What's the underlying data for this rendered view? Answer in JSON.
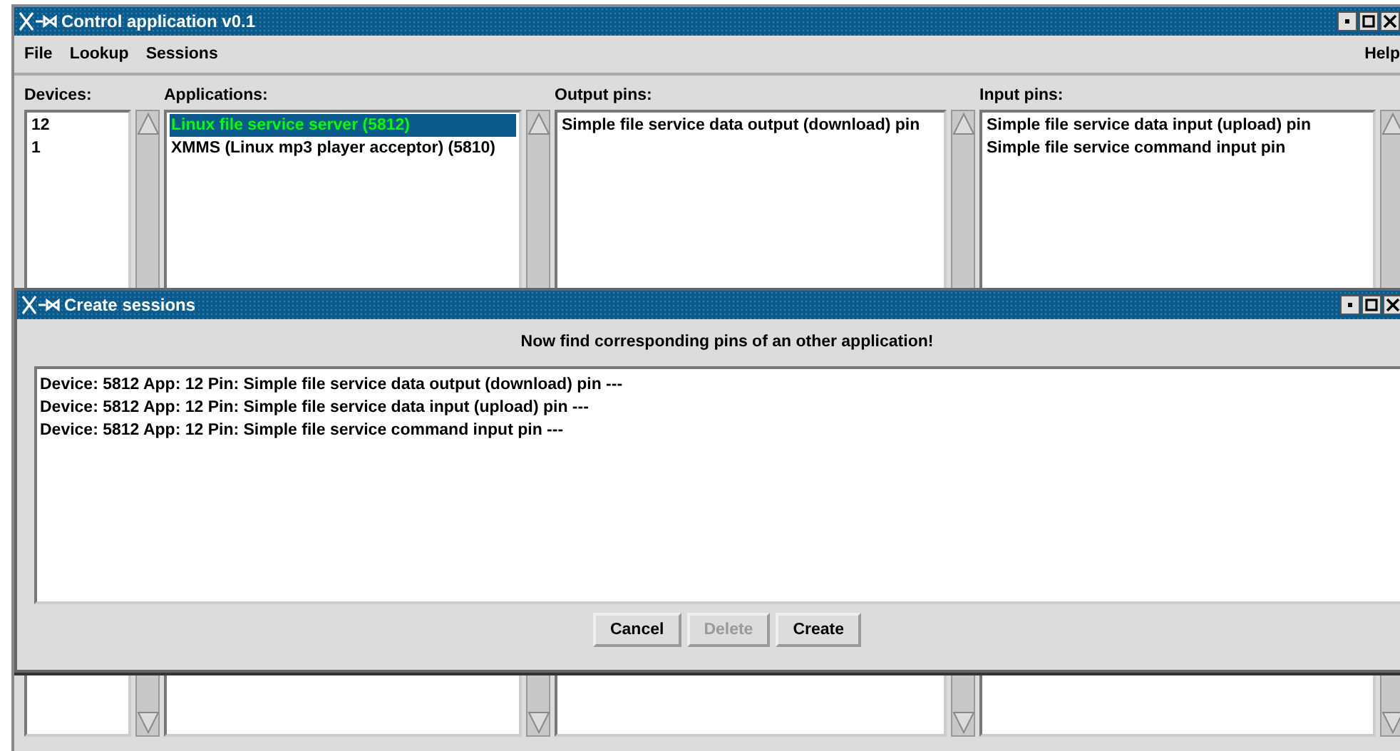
{
  "main_window": {
    "title": "Control application v0.1",
    "menu": [
      {
        "label": "File"
      },
      {
        "label": "Lookup"
      },
      {
        "label": "Sessions"
      }
    ],
    "help_menu": {
      "label": "Help"
    },
    "panels": [
      {
        "heading": "Devices:",
        "items": [
          {
            "text": "12",
            "selected": false
          },
          {
            "text": "1",
            "selected": false
          }
        ]
      },
      {
        "heading": "Applications:",
        "items": [
          {
            "text": "Linux file service server (5812)",
            "selected": true
          },
          {
            "text": "XMMS (Linux mp3 player acceptor) (5810)",
            "selected": false
          }
        ]
      },
      {
        "heading": "Output pins:",
        "items": [
          {
            "text": "Simple file service data output (download) pin",
            "selected": false
          }
        ]
      },
      {
        "heading": "Input pins:",
        "items": [
          {
            "text": "Simple file service data input (upload) pin",
            "selected": false
          },
          {
            "text": "Simple file service command input pin",
            "selected": false
          }
        ]
      }
    ]
  },
  "dialog": {
    "title": "Create sessions",
    "message": "Now find corresponding pins of an other application!",
    "lines": [
      "Device: 5812 App: 12 Pin: Simple file service data output (download) pin ---",
      "Device: 5812 App: 12 Pin: Simple file service data input (upload) pin ---",
      "Device: 5812 App: 12 Pin: Simple file service command input pin ---"
    ],
    "buttons": [
      {
        "label": "Cancel",
        "disabled": false
      },
      {
        "label": "Delete",
        "disabled": true
      },
      {
        "label": "Create",
        "disabled": false
      }
    ]
  }
}
